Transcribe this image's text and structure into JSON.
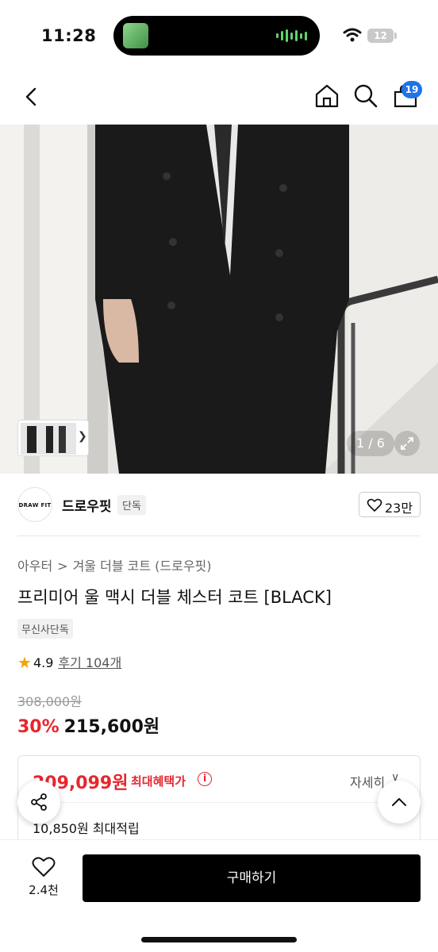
{
  "status_bar": {
    "time": "11:28",
    "battery": "12"
  },
  "nav": {
    "cart_count": "19"
  },
  "gallery": {
    "counter": "1 / 6"
  },
  "brand": {
    "logo_text": "DRAW FIT",
    "name": "드로우핏",
    "tag": "단독",
    "like_count": "23만"
  },
  "breadcrumb": {
    "category": "아우터",
    "subcategory": "겨울 더블 코트 (드로우핏)"
  },
  "product": {
    "title": "프리미어 울 맥시 더블 체스터 코트 [BLACK]",
    "badge": "무신사단독",
    "rating": "4.9",
    "reviews": "후기 104개",
    "original_price": "308,000원",
    "discount": "30%",
    "sale_price": "215,600원"
  },
  "benefit": {
    "max_price": "209,099원",
    "max_label": "최대혜택가",
    "detail_label": "자세히",
    "points": "10,850원 최대적립"
  },
  "bottom_bar": {
    "wish_count": "2.4천",
    "buy_label": "구매하기"
  },
  "colors": {
    "accent_red": "#e8252e",
    "badge_blue": "#1e74e8"
  }
}
